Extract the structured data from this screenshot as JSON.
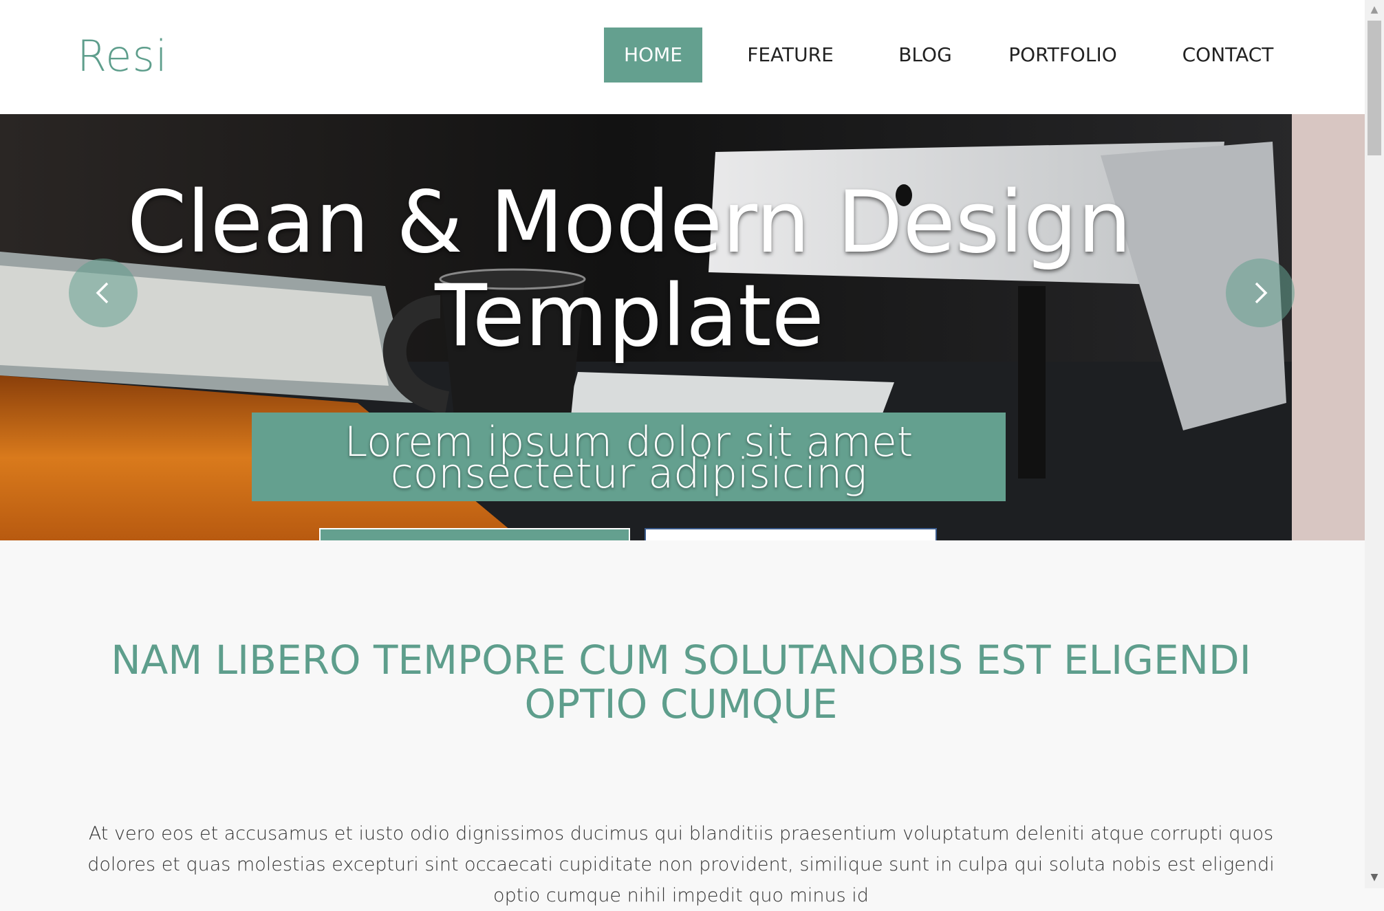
{
  "header": {
    "logo": "Resi",
    "nav": [
      {
        "label": "HOME",
        "active": true
      },
      {
        "label": "FEATURE",
        "active": false
      },
      {
        "label": "BLOG",
        "active": false
      },
      {
        "label": "PORTFOLIO",
        "active": false
      },
      {
        "label": "CONTACT",
        "active": false
      }
    ]
  },
  "hero": {
    "title": "Clean & Modern Design Template",
    "subtitle": "Lorem ipsum dolor sit amet consectetur adipisicing",
    "prev_icon": "chevron-left-icon",
    "next_icon": "chevron-right-icon"
  },
  "section": {
    "heading": "NAM LIBERO TEMPORE CUM SOLUTANOBIS EST ELIGENDI OPTIO CUMQUE",
    "text": "At vero eos et accusamus et iusto odio dignissimos ducimus qui blanditiis praesentium voluptatum deleniti atque corrupti quos dolores et quas molestias excepturi sint occaecati cupiditate non provident, similique sunt in culpa qui soluta nobis est eligendi optio cumque nihil impedit quo minus id"
  },
  "colors": {
    "accent": "#64a08f",
    "text": "#222222",
    "page_bg": "#f8f8f8"
  }
}
